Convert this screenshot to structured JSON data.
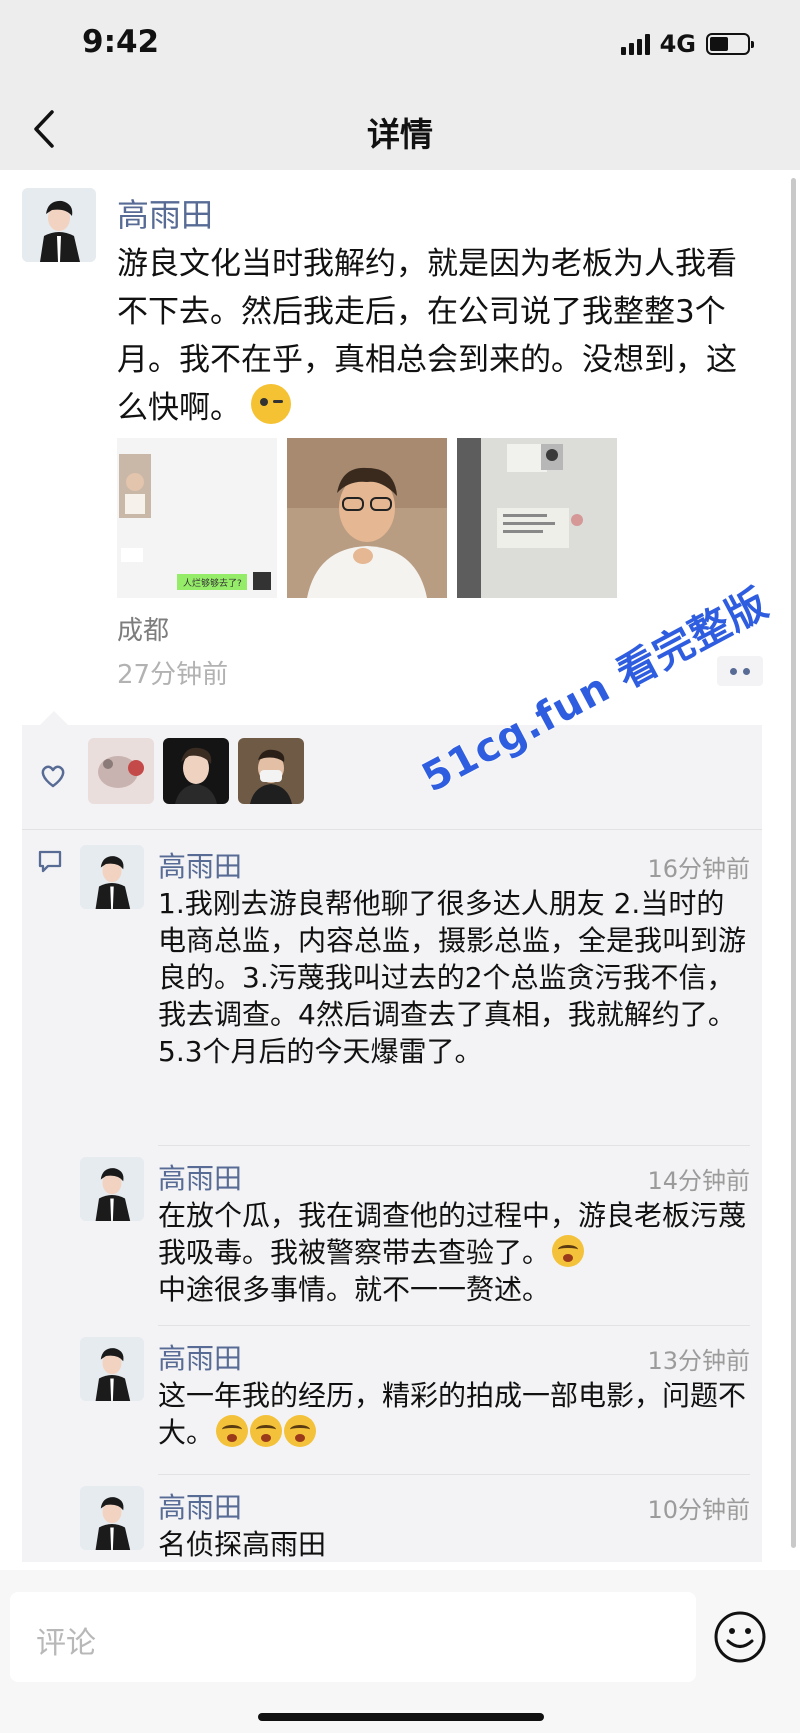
{
  "status_bar": {
    "time": "9:42",
    "network": "4G",
    "battery_level": 0.5
  },
  "nav": {
    "title": "详情",
    "back_icon": "chevron-left-icon"
  },
  "post": {
    "author": "高雨田",
    "text": "游良文化当时我解约，就是因为老板为人我看不下去。然后我走后，在公司说了我整整3个月。我不在乎，真相总会到来的。没想到，这么快啊。",
    "emoji": "wink-emoji",
    "photos": [
      {
        "name": "chat-screenshot-photo",
        "caption": "人烂够够去了?"
      },
      {
        "name": "video-selfie-photo"
      },
      {
        "name": "document-photo"
      }
    ],
    "location": "成都",
    "time": "27分钟前"
  },
  "likes": {
    "icon": "heart-icon",
    "count": 3
  },
  "comments": [
    {
      "author": "高雨田",
      "time": "16分钟前",
      "text": "1.我刚去游良帮他聊了很多达人朋友 2.当时的电商总监，内容总监，摄影总监，全是我叫到游良的。3.污蔑我叫过去的2个总监贪污我不信，我去调查。4然后调查去了真相，我就解约了。5.3个月后的今天爆雷了。"
    },
    {
      "author": "高雨田",
      "time": "14分钟前",
      "text": "在放个瓜，我在调查他的过程中，游良老板污蔑我吸毒。我被警察带去查验了。",
      "text2": "中途很多事情。就不一一赘述。"
    },
    {
      "author": "高雨田",
      "time": "13分钟前",
      "text": "这一年我的经历，精彩的拍成一部电影，问题不大。"
    },
    {
      "author": "高雨田",
      "time": "10分钟前",
      "text": "名侦探高雨田"
    }
  ],
  "watermark": "51cg.fun 看完整版",
  "input": {
    "placeholder": "评论",
    "emoji_icon": "smile-icon"
  },
  "colors": {
    "link": "#576b95",
    "background": "#ededed",
    "watermark": "#2f5de0"
  }
}
